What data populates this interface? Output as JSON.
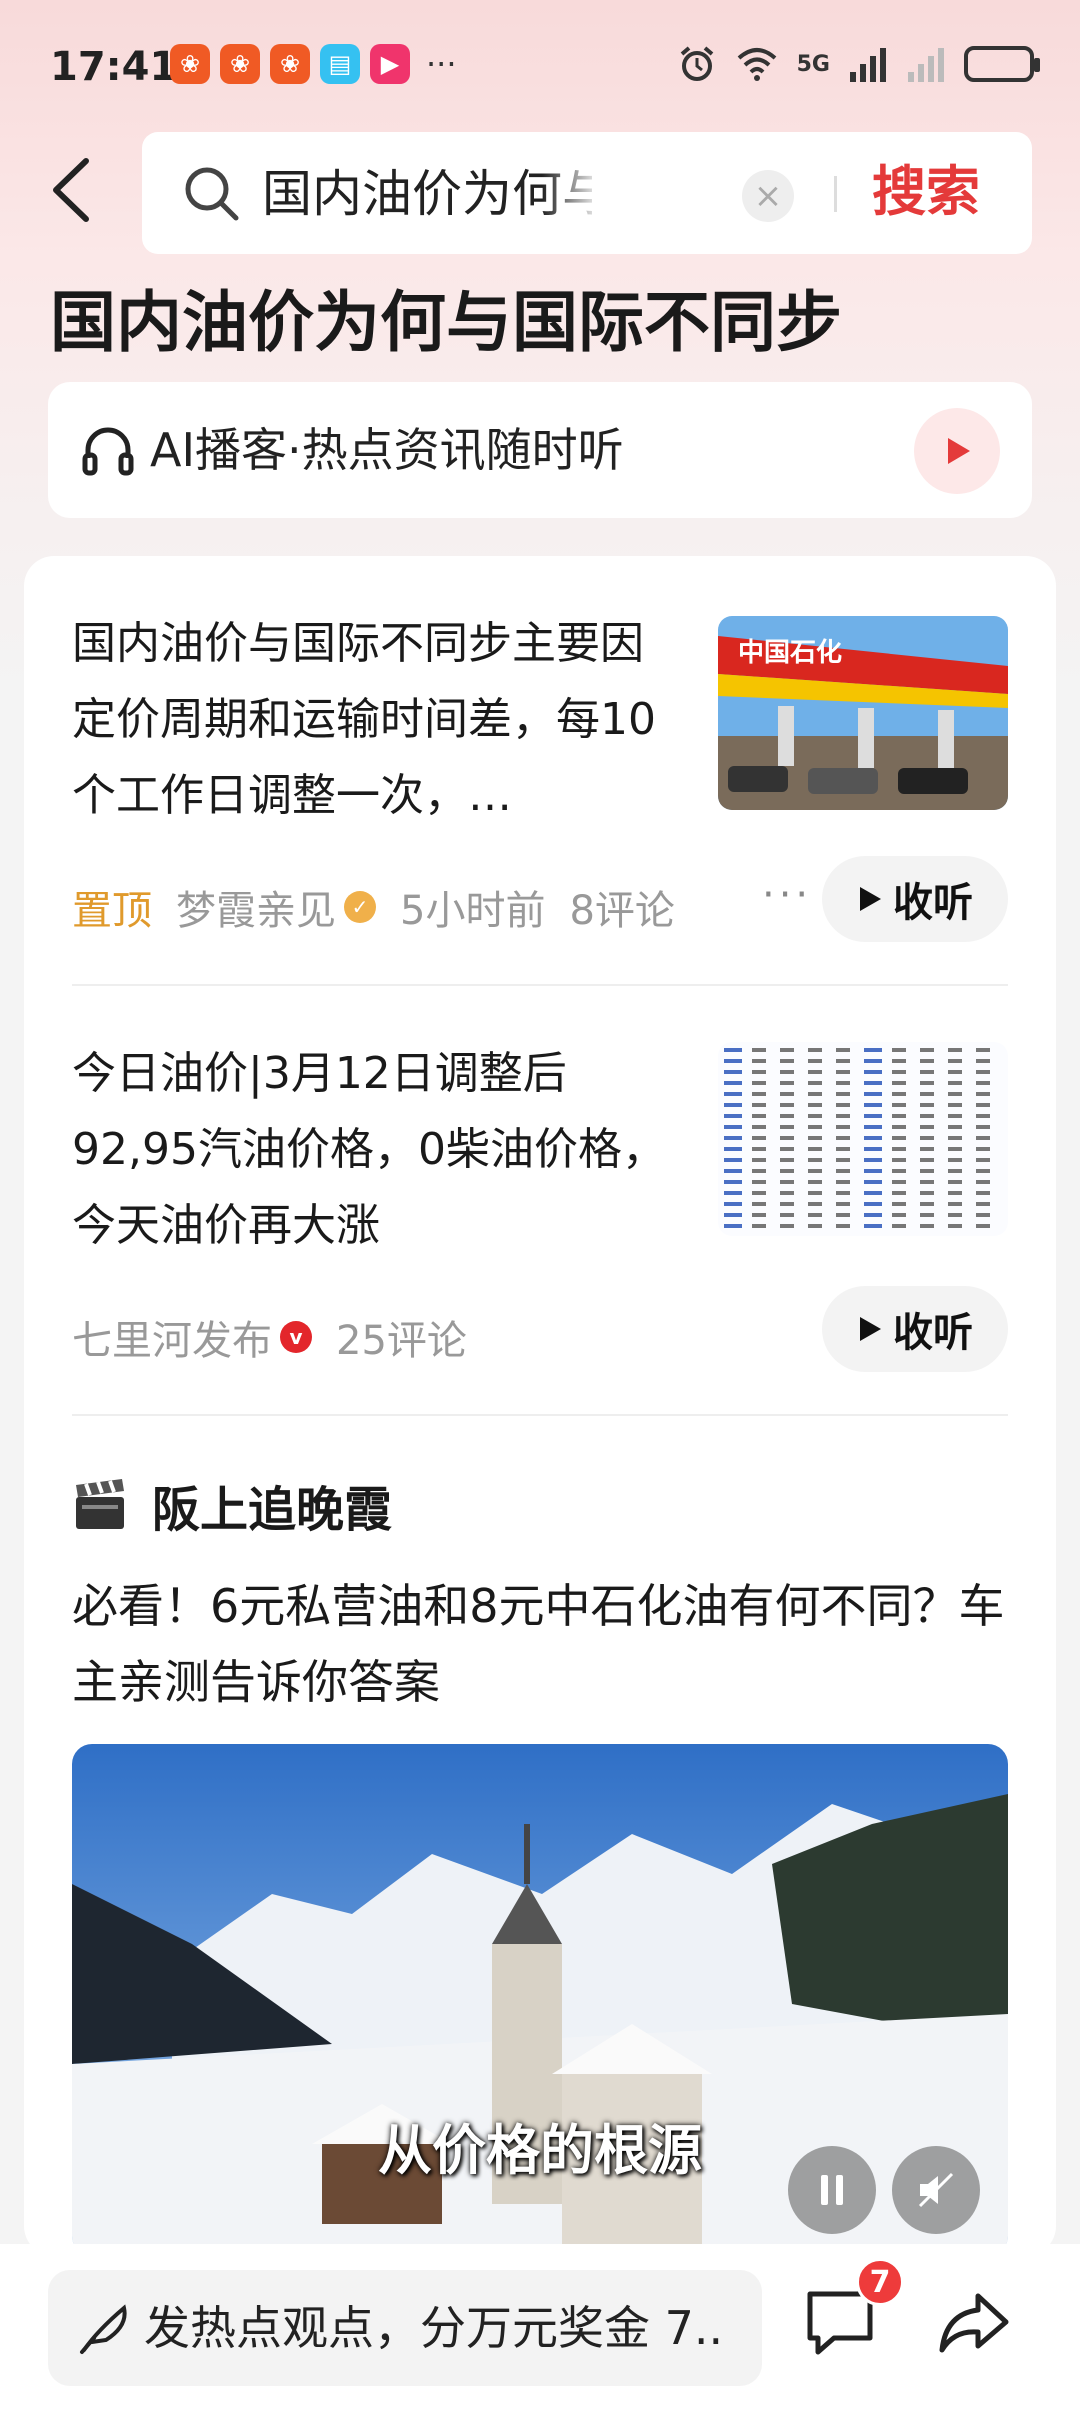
{
  "status_bar": {
    "time": "17:41",
    "network": "5G",
    "app_icons": [
      {
        "name": "kuaishou-icon",
        "color": "#f05a24"
      },
      {
        "name": "kuaishou-icon",
        "color": "#f05a24"
      },
      {
        "name": "kuaishou-icon",
        "color": "#f05a24"
      },
      {
        "name": "book-icon",
        "color": "#35c1f1"
      },
      {
        "name": "video-play-icon",
        "color": "#f0346c"
      }
    ],
    "more": "···"
  },
  "search": {
    "query": "国内油价为何与国际不同步",
    "button_label": "搜索"
  },
  "page": {
    "title": "国内油价为何与国际不同步"
  },
  "ai_podcast": {
    "label": "AI播客·热点资讯随时听"
  },
  "articles": [
    {
      "title": "国内油价与国际不同步主要因定价周期和运输时间差，每10个工作日调整一次，…",
      "pinned": "置顶",
      "author": "梦霞亲见",
      "time": "5小时前",
      "comments": "8评论",
      "listen_label": "收听"
    },
    {
      "title": "今日油价|3月12日调整后92,95汽油价格，0柴油价格，今天油价再大涨",
      "author": "七里河发布",
      "comments": "25评论",
      "listen_label": "收听"
    }
  ],
  "video_post": {
    "author": "阪上追晚霞",
    "title": "必看！6元私营油和8元中石化油有何不同？车主亲测告诉你答案",
    "caption": "从价格的根源"
  },
  "bottom_bar": {
    "comment_placeholder": "发热点观点，分万元奖金 7..",
    "comment_count": "7"
  },
  "colors": {
    "accent_red": "#e43a3a",
    "pinned_orange": "#e09a2c"
  }
}
